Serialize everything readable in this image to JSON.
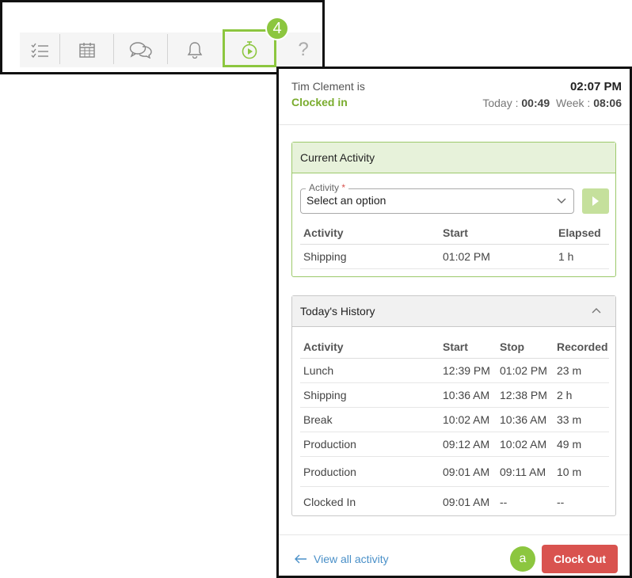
{
  "toolbar": {
    "items": [
      {
        "icon": "checklist-icon"
      },
      {
        "icon": "calendar-icon"
      },
      {
        "icon": "chat-icon"
      },
      {
        "icon": "bell-icon"
      },
      {
        "icon": "timer-icon",
        "selected": true
      },
      {
        "icon": "help-icon",
        "glyph": "?"
      }
    ],
    "callout": "4"
  },
  "header": {
    "user_line": "Tim Clement is",
    "status": "Clocked in",
    "time": "02:07 PM",
    "today_label": "Today :",
    "today_value": "00:49",
    "week_label": "Week :",
    "week_value": "08:06"
  },
  "current": {
    "title": "Current Activity",
    "select_label": "Activity",
    "required_mark": "*",
    "select_value": "Select an option",
    "columns": [
      "Activity",
      "Start",
      "Elapsed"
    ],
    "rows": [
      {
        "activity": "Shipping",
        "start": "01:02 PM",
        "elapsed": "1 h"
      }
    ]
  },
  "history": {
    "title": "Today's History",
    "columns": [
      "Activity",
      "Start",
      "Stop",
      "Recorded"
    ],
    "rows": [
      {
        "activity": "Lunch",
        "start": "12:39 PM",
        "stop": "01:02 PM",
        "recorded": "23 m"
      },
      {
        "activity": "Shipping",
        "start": "10:36 AM",
        "stop": "12:38 PM",
        "recorded": "2 h"
      },
      {
        "activity": "Break",
        "start": "10:02 AM",
        "stop": "10:36 AM",
        "recorded": "33 m"
      },
      {
        "activity": "Production",
        "start": "09:12 AM",
        "stop": "10:02 AM",
        "recorded": "49 m"
      },
      {
        "activity": "Production",
        "start": "09:01 AM",
        "stop": "09:11 AM",
        "recorded": "10 m"
      },
      {
        "activity": "Clocked In",
        "start": "09:01 AM",
        "stop": "--",
        "recorded": "--"
      }
    ]
  },
  "footer": {
    "view_all": "View all activity",
    "callout": "a",
    "clock_out": "Clock Out"
  },
  "colors": {
    "accent_green": "#8cc63f",
    "status_green": "#7aac2e",
    "danger": "#d9534f",
    "link": "#4a90c8"
  }
}
